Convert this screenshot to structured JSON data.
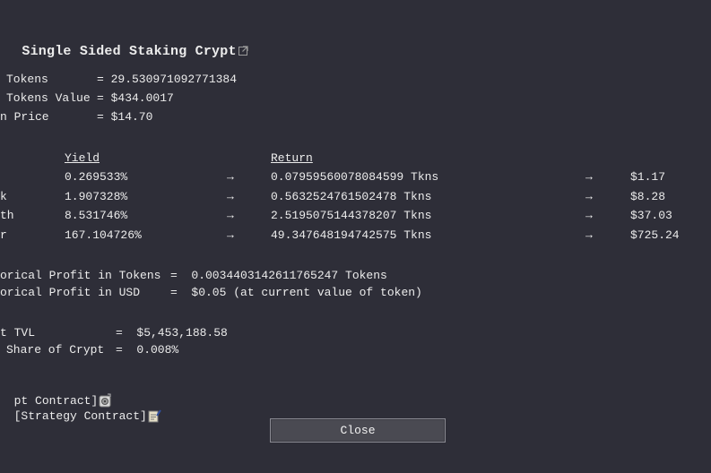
{
  "title": "Single Sided Staking Crypt",
  "icons": {
    "external_link": "external-link-icon",
    "crypt_contract": "vault-icon",
    "strategy_contract": "contract-document-icon"
  },
  "summary": {
    "tokens_label": "Tokens",
    "tokens_value": "= 29.530971092771384",
    "tokens_value_label": "Tokens Value",
    "tokens_value_value": "= $434.0017",
    "price_label": "n Price",
    "price_value": "= $14.70"
  },
  "table": {
    "yield_header": "Yield",
    "return_header": "Return",
    "arrow": "→",
    "rows": [
      {
        "period": "",
        "yield": "0.269533%",
        "return": "0.07959560078084599 Tkns",
        "usd": "$1.17"
      },
      {
        "period": "k",
        "yield": "1.907328%",
        "return": "0.5632524761502478 Tkns",
        "usd": "$8.28"
      },
      {
        "period": "th",
        "yield": "8.531746%",
        "return": "2.5195075144378207 Tkns",
        "usd": "$37.03"
      },
      {
        "period": "r",
        "yield": "167.104726%",
        "return": "49.347648194742575 Tkns",
        "usd": "$725.24"
      }
    ]
  },
  "profit": {
    "tokens_label": "orical Profit in Tokens",
    "tokens_value": "=  0.0034403142611765247 Tokens",
    "usd_label": "orical Profit in USD",
    "usd_value": "=  $0.05 (at current value of token)"
  },
  "tvl": {
    "tvl_label": "t TVL",
    "tvl_value": "=  $5,453,188.58",
    "share_label": "Share of Crypt",
    "share_value": "=  0.008%"
  },
  "links": {
    "crypt_contract": "pt Contract]",
    "strategy_contract": "[Strategy Contract]"
  },
  "close_label": "Close"
}
